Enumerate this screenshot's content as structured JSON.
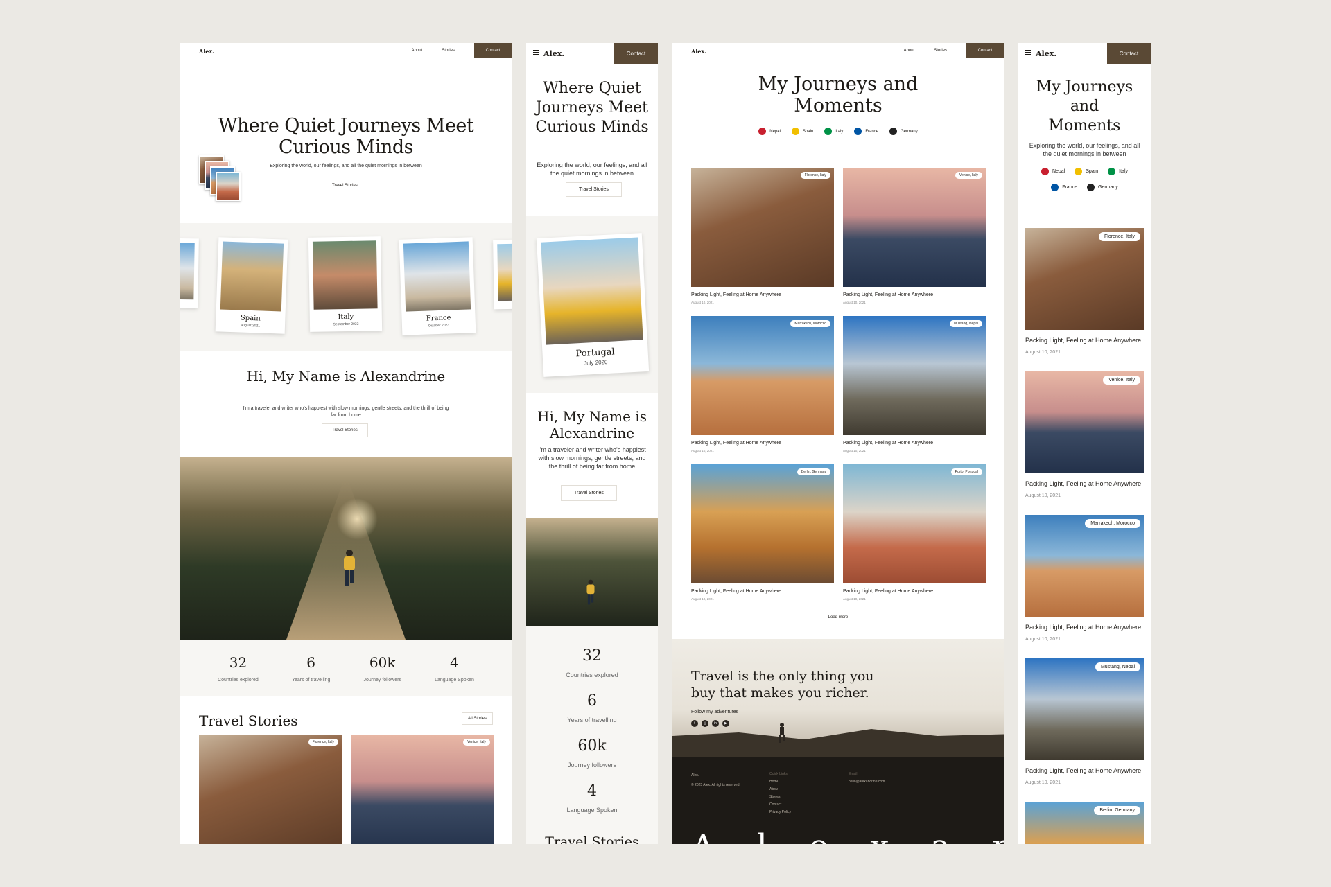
{
  "colors": {
    "background": "#ebe9e4",
    "accent": "#5a4935",
    "text": "#1d1a16",
    "footer": "#1d1a16"
  },
  "brand": {
    "logo_small": "Alex.",
    "logo_mobile": "Alex."
  },
  "nav": {
    "about": "About",
    "stories": "Stories",
    "contact": "Contact"
  },
  "home": {
    "hero_title": "Where Quiet Journeys Meet Curious Minds",
    "hero_subtitle": "Exploring the world, our feelings, and all the quiet mornings in between",
    "about_button": "Travel Stories",
    "polaroids": [
      {
        "place": "Spain",
        "date": "August 2021"
      },
      {
        "place": "Italy",
        "date": "September 2022"
      },
      {
        "place": "France",
        "date": "October 2023"
      }
    ],
    "mobile_polaroid": {
      "place": "Portugal",
      "date": "July 2020"
    },
    "about_title": "Hi, My Name is Alexandrine",
    "about_text": "I'm a traveler and writer who's happiest with slow mornings, gentle streets, and the thrill of being far from home",
    "stats": [
      {
        "value": "32",
        "label": "Countries explored"
      },
      {
        "value": "6",
        "label": "Years of travelling"
      },
      {
        "value": "60k",
        "label": "Journey followers"
      },
      {
        "value": "4",
        "label": "Language Spoken"
      }
    ],
    "stories_title": "Travel Stories",
    "all_stories": "All Stories"
  },
  "journeys": {
    "title": "My Journeys and Moments",
    "subtitle": "Exploring the world, our feelings, and all the quiet mornings in between",
    "filters": [
      {
        "name": "Nepal",
        "color": "#c8202f"
      },
      {
        "name": "Spain",
        "color": "#f1bf00"
      },
      {
        "name": "Italy",
        "color": "#009246"
      },
      {
        "name": "France",
        "color": "#0055a4"
      },
      {
        "name": "Germany",
        "color": "#222222"
      }
    ],
    "cards": [
      {
        "tag": "Florence, Italy",
        "title": "Packing Light, Feeling at Home Anywhere",
        "date": "August 10, 2021"
      },
      {
        "tag": "Venice, Italy",
        "title": "Packing Light, Feeling at Home Anywhere",
        "date": "August 10, 2021"
      },
      {
        "tag": "Marrakech, Morocco",
        "title": "Packing Light, Feeling at Home Anywhere",
        "date": "August 10, 2021"
      },
      {
        "tag": "Mustang, Nepal",
        "title": "Packing Light, Feeling at Home Anywhere",
        "date": "August 10, 2021"
      },
      {
        "tag": "Berlin, Germany",
        "title": "Packing Light, Feeling at Home Anywhere",
        "date": "August 10, 2021"
      },
      {
        "tag": "Porto, Portugal",
        "title": "Packing Light, Feeling at Home Anywhere",
        "date": "August 10, 2021"
      }
    ],
    "load_more": "Load more",
    "quote": "Travel is the only thing you buy that makes you richer.",
    "follow": "Follow my adventures",
    "social": [
      "f",
      "◎",
      "in",
      "▶"
    ]
  },
  "footer": {
    "brand": "Alex.",
    "copyright": "© 2025 Alex. All rights reserved.",
    "quick_links_title": "Quick Links",
    "links": [
      "Home",
      "About",
      "Stories",
      "Contact",
      "Privacy Policy"
    ],
    "email_title": "Email",
    "email": "hello@alexandrine.com",
    "big_word": "Alexandrine"
  }
}
